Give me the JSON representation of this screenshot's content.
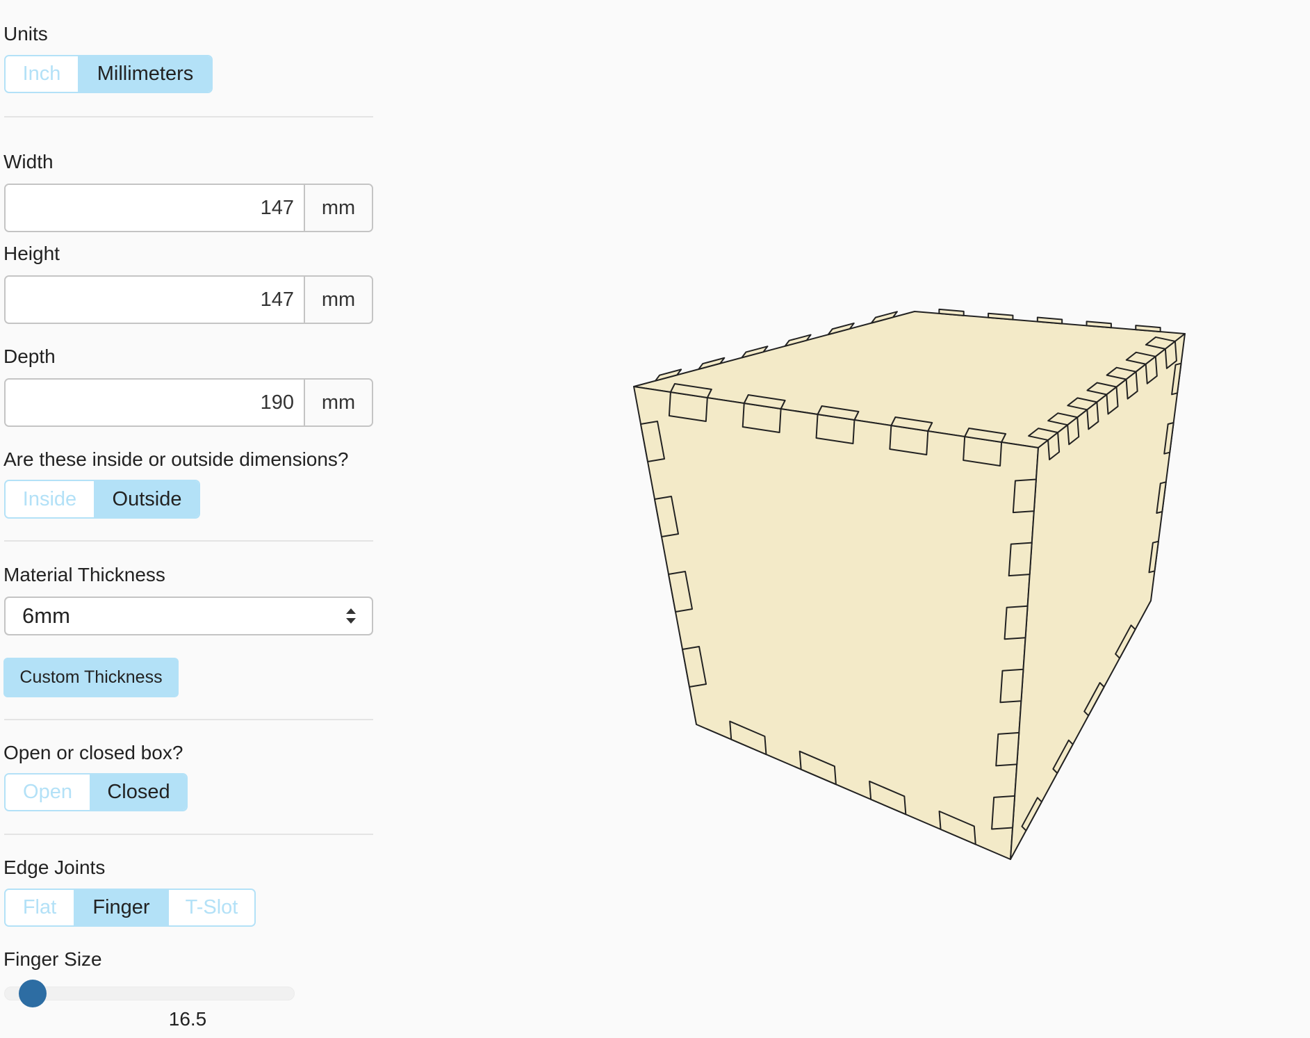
{
  "units": {
    "label": "Units",
    "options": [
      "Inch",
      "Millimeters"
    ],
    "selected": "Millimeters"
  },
  "width": {
    "label": "Width",
    "value": "147",
    "unit": "mm"
  },
  "height": {
    "label": "Height",
    "value": "147",
    "unit": "mm"
  },
  "depth": {
    "label": "Depth",
    "value": "190",
    "unit": "mm"
  },
  "dimensions": {
    "label": "Are these inside or outside dimensions?",
    "options": [
      "Inside",
      "Outside"
    ],
    "selected": "Outside"
  },
  "thickness": {
    "label": "Material Thickness",
    "selected": "6mm",
    "custom_button": "Custom Thickness"
  },
  "box_type": {
    "label": "Open or closed box?",
    "options": [
      "Open",
      "Closed"
    ],
    "selected": "Closed"
  },
  "edge_joints": {
    "label": "Edge Joints",
    "options": [
      "Flat",
      "Finger",
      "T-Slot"
    ],
    "selected": "Finger"
  },
  "finger_size": {
    "label": "Finger Size",
    "value": "16.5",
    "slider_fraction": 0.03
  },
  "colors": {
    "accent": "#b3e1f7",
    "slider_thumb": "#2d6da3",
    "box_fill": "#f3eac8",
    "box_stroke": "#222222",
    "background": "#fafafa"
  }
}
